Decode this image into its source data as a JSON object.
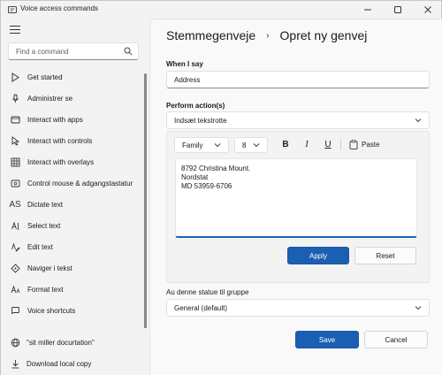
{
  "window": {
    "title": "Voice access commands",
    "minimize_icon": "minimize-icon",
    "maximize_icon": "maximize-icon",
    "close_icon": "close-icon"
  },
  "sidebar": {
    "search_placeholder": "Find a command",
    "items": [
      {
        "label": "Get started",
        "icon": "play-icon"
      },
      {
        "label": "Administrer se",
        "icon": "microphone-icon"
      },
      {
        "label": "Interact with apps",
        "icon": "apps-icon"
      },
      {
        "label": "Interact with controls",
        "icon": "cursor-icon"
      },
      {
        "label": "Interact with overlays",
        "icon": "grid-icon"
      },
      {
        "label": "Control mouse & adgangstastatur",
        "icon": "mouse-icon"
      },
      {
        "label": "Dictate text",
        "icon": "dictate-icon"
      },
      {
        "label": "Select text",
        "icon": "select-text-icon"
      },
      {
        "label": "Edit text",
        "icon": "edit-text-icon"
      },
      {
        "label": "Naviger i tekst",
        "icon": "navigate-icon"
      },
      {
        "label": "Format text",
        "icon": "format-text-icon"
      },
      {
        "label": "Voice shortcuts",
        "icon": "voice-shortcuts-icon"
      }
    ],
    "footer": {
      "docs_label": "\"sit miller docurtation\"",
      "download_label": "Download local copy"
    }
  },
  "main": {
    "breadcrumb": {
      "parent": "Stemmegenveje",
      "current": "Opret ny genvej"
    },
    "when_i_say": {
      "label": "When I say",
      "value": "Address"
    },
    "perform_action": {
      "label": "Perform action(s)",
      "selected": "Indsæt tekstrotte"
    },
    "toolbar": {
      "font_family": "Family",
      "font_size": "8",
      "bold": "B",
      "italic": "I",
      "underline": "U",
      "paste_label": "Paste"
    },
    "editor_lines": [
      "8792 Christina Mount.",
      "Nordstat",
      "MD 53959-6706"
    ],
    "apply_label": "Apply",
    "reset_label": "Reset",
    "group": {
      "label": "Au denne statue til gruppe",
      "selected": "General (default)"
    },
    "save_label": "Save",
    "cancel_label": "Cancel"
  },
  "colors": {
    "accent": "#1b5fb3",
    "background": "#f3f3f3",
    "surface": "#f9f9f9"
  }
}
